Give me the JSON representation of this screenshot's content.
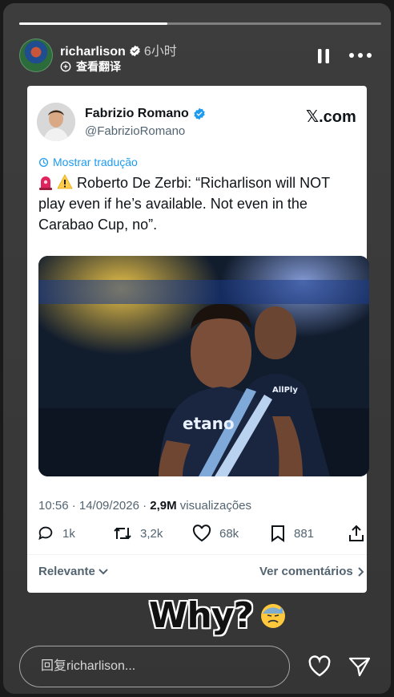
{
  "story": {
    "progress_fraction": 0.41,
    "username": "richarlison",
    "time_ago": "6小时",
    "translate_label": "查看翻译",
    "reply_placeholder": "回复richarlison...",
    "icons": {
      "pause": "pause-icon",
      "more": "more-icon",
      "like": "heart-icon",
      "send": "send-icon",
      "translate": "translate-icon"
    }
  },
  "tweet": {
    "author_name": "Fabrizio Romano",
    "author_handle": "@FabrizioRomano",
    "brand": "𝕏.com",
    "translate_link": "Mostrar tradução",
    "text": "Roberto De Zerbi: “Richarlison will NOT play even if he’s available. Not even in the Carabao Cup, no”.",
    "timestamp": "10:56 · 14/09/2026 · ",
    "views_count": "2,9M",
    "views_label": " visualizações",
    "replies": "1k",
    "retweets": "3,2k",
    "likes": "68k",
    "bookmarks": "881",
    "sort_label": "Relevante",
    "comments_label": "Ver comentários",
    "colors": {
      "verified": "#1d9bf0",
      "link": "#1d9bf0",
      "text": "#0f1419",
      "muted": "#536471"
    }
  },
  "photo": {
    "jersey_text": "etano",
    "sponsor_small": "AllPly"
  },
  "sticker": {
    "text": "Why?"
  }
}
